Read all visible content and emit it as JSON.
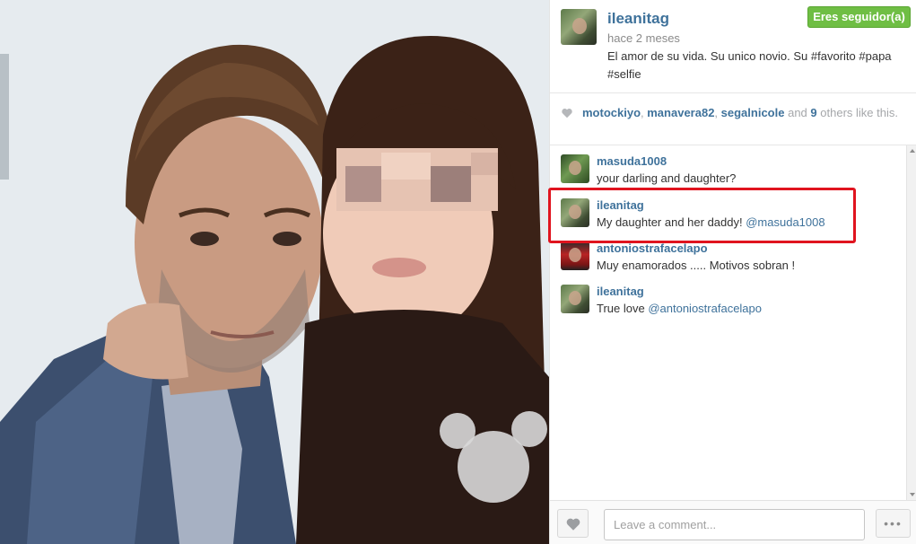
{
  "post": {
    "owner": "ileanitag",
    "follow_button": "Eres seguidor(a)",
    "timestamp": "hace 2 meses",
    "caption": "El amor de su vida. Su unico novio. Su #favorito #papa #selfie"
  },
  "likes": {
    "users": [
      "motockiyo",
      "manavera82",
      "segalnicole"
    ],
    "separator": ", ",
    "and": "and",
    "others_count": "9",
    "others_suffix": "others like this."
  },
  "comments": [
    {
      "user": "masuda1008",
      "text": "your darling and daughter?",
      "mention": ""
    },
    {
      "user": "ileanitag",
      "text": "My daughter and her daddy! ",
      "mention": "@masuda1008"
    },
    {
      "user": "antoniostrafacelapo",
      "text": "Muy enamorados ..... Motivos sobran !",
      "mention": ""
    },
    {
      "user": "ileanitag",
      "text": "True love ",
      "mention": "@antoniostrafacelapo"
    }
  ],
  "footer": {
    "comment_placeholder": "Leave a comment...",
    "more_label": "•••"
  },
  "colors": {
    "link_blue": "#3f729b",
    "follow_green": "#6fbe44",
    "highlight_red": "#e0141f"
  },
  "icons": [
    "heart-icon",
    "more-icon",
    "scroll-up-icon",
    "scroll-down-icon"
  ]
}
